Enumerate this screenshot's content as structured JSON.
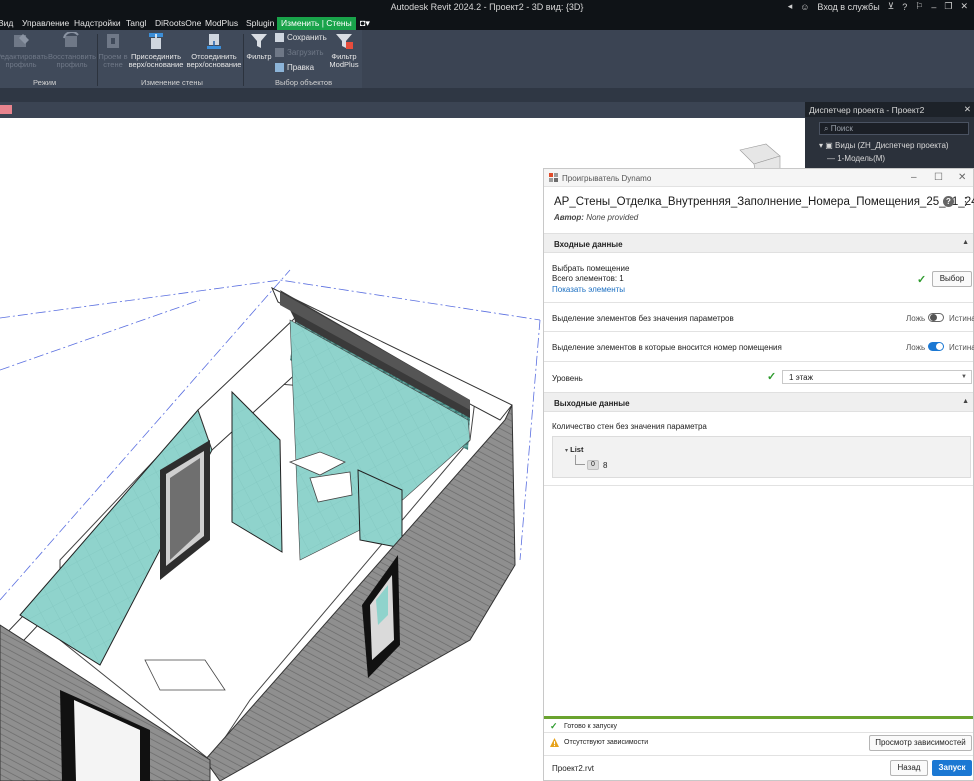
{
  "window": {
    "title": "Autodesk Revit 2024.2 - Проект2 - 3D вид: {3D}",
    "signin": "Вход в службы"
  },
  "menu": [
    {
      "label": "Вид",
      "active": false
    },
    {
      "label": "Управление",
      "active": false
    },
    {
      "label": "Надстройки",
      "active": false
    },
    {
      "label": "Tangl",
      "active": false
    },
    {
      "label": "DiRootsOne",
      "active": false
    },
    {
      "label": "ModPlus",
      "active": false
    },
    {
      "label": "Splugin",
      "active": false
    },
    {
      "label": "Изменить | Стены",
      "active": true
    }
  ],
  "ribbon": {
    "edit_profile": "Редактировать профиль",
    "restore_profile": "Восстановить профиль",
    "wall_opening": "Проем в стене",
    "attach_top_base": "Присоединить верх/основание",
    "detach_top_base": "Отсоединить верх/основание",
    "filter": "Фильтр",
    "save": "Сохранить",
    "load": "Загрузить",
    "edit": "Правка",
    "filter_modplus": "Фильтр ModPlus",
    "panel_mode": "Режим",
    "panel_modify_wall": "Изменение стены",
    "panel_selection": "Выбор объектов"
  },
  "project_browser": {
    "title": "Диспетчер проекта - Проект2",
    "search_placeholder": "Поиск",
    "views_node": "Виды (ZH_Диспетчер проекта)",
    "model_node": "1-Модель(М)"
  },
  "dynamo": {
    "window_title": "Проигрыватель Dynamo",
    "script_name": "АР_Стены_Отделка_Внутренняя_Заполнение_Номера_Помещения_25_01_24",
    "author_label": "Автор:",
    "author_value": "None provided",
    "inputs_header": "Входные данные",
    "select_room_label": "Выбрать помещение",
    "total_elements": "Всего элементов: 1",
    "show_elements": "Показать элементы",
    "select_button": "Выбор",
    "toggle1_label": "Выделение элементов без значения параметров",
    "toggle2_label": "Выделение элементов в которые вносится номер помещения",
    "false_label": "Ложь",
    "true_label": "Истина",
    "level_label": "Уровень",
    "level_value": "1 этаж",
    "outputs_header": "Выходные данные",
    "output_label": "Количество стен без значения параметра",
    "list_label": "List",
    "list_index": "0",
    "list_value": "8",
    "status_ready": "Готово к запуску",
    "status_missing": "Отсутствуют зависимости",
    "view_deps_button": "Просмотр зависимостей",
    "file_name": "Проект2.rvt",
    "back_button": "Назад",
    "run_button": "Запуск"
  },
  "colors": {
    "accent_green": "#19a34a",
    "primary_blue": "#1b78d3",
    "wall_finish": "#8fd3cc"
  }
}
